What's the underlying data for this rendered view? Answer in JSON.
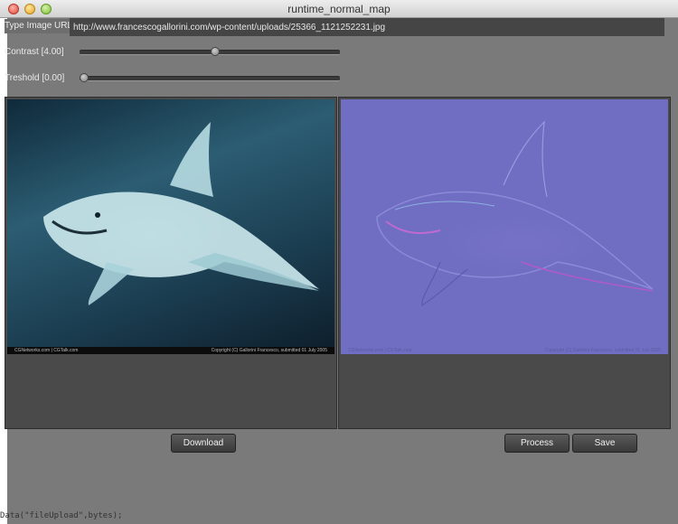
{
  "window": {
    "title": "runtime_normal_map"
  },
  "url": {
    "label": "Type Image URL",
    "value": "http://www.francescogallorini.com/wp-content/uploads/25366_1121252231.jpg"
  },
  "contrast": {
    "label": "Contrast [4.00]",
    "level_fraction": 0.52
  },
  "threshold": {
    "label": "Treshold [0.00]",
    "level_fraction": 0.0
  },
  "source_image": {
    "credit_left": "CGNetworks.com | CGTalk.com",
    "credit_right": "Copyright (C) Gallorini Francesco, submitted 01 July 2005"
  },
  "normal_image": {
    "credit_left": "CGNetworks.com | CGTalk.com",
    "credit_right": "Copyright (C) Gallorini Francesco, submitted 01 July 2005"
  },
  "buttons": {
    "download": "Download",
    "process": "Process",
    "save": "Save"
  },
  "background_code": {
    "bottom_line": "Data(\"fileUpload\",bytes);"
  },
  "colors": {
    "window_bg": "#7a7a7a",
    "normal_map": "#6f6ec2"
  }
}
